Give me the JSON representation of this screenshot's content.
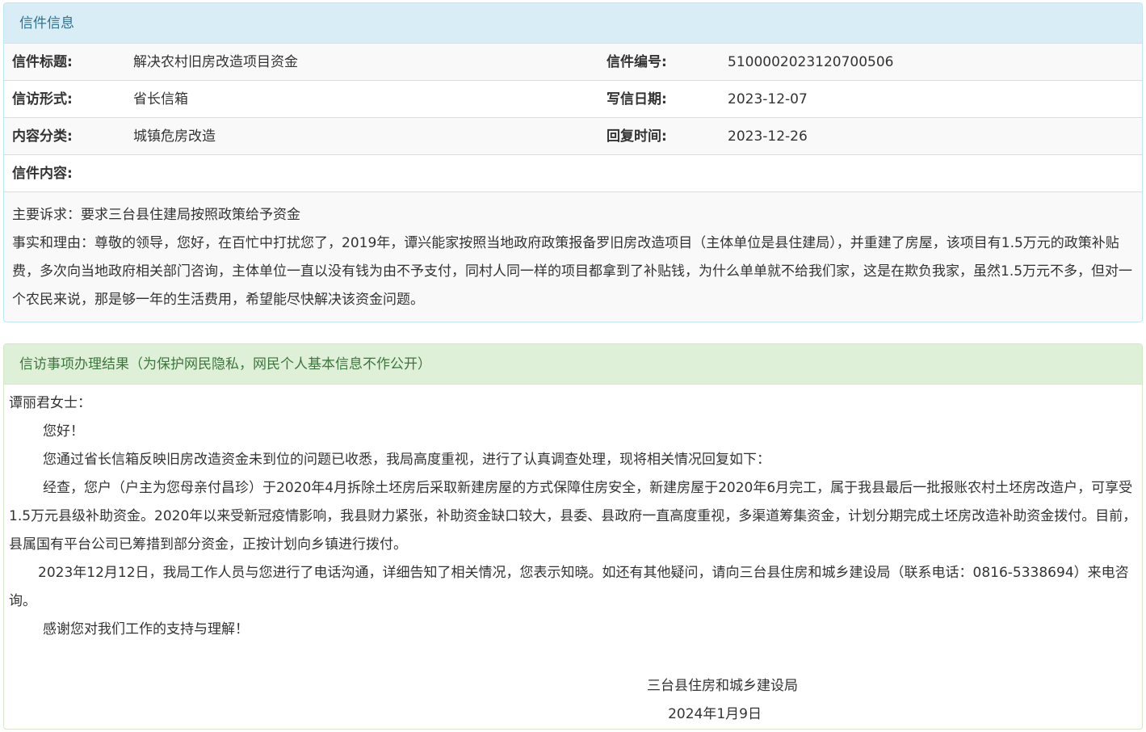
{
  "letter_panel": {
    "heading": "信件信息",
    "fields": {
      "title_label": "信件标题:",
      "title_value": "解决农村旧房改造项目资金",
      "number_label": "信件编号:",
      "number_value": "5100002023120700506",
      "form_label": "信访形式:",
      "form_value": "省长信箱",
      "write_date_label": "写信日期:",
      "write_date_value": "2023-12-07",
      "category_label": "内容分类:",
      "category_value": "城镇危房改造",
      "reply_time_label": "回复时间:",
      "reply_time_value": "2023-12-26",
      "content_label": "信件内容:"
    },
    "content": {
      "demand": "主要诉求：要求三台县住建局按照政策给予资金",
      "facts": "事实和理由：尊敬的领导，您好，在百忙中打扰您了，2019年，谭兴能家按照当地政府政策报备罗旧房改造项目（主体单位是县住建局），并重建了房屋，该项目有1.5万元的政策补贴费，多次向当地政府相关部门咨询，主体单位一直以没有钱为由不予支付，同村人同一样的项目都拿到了补贴钱，为什么单单就不给我们家，这是在欺负我家，虽然1.5万元不多，但对一个农民来说，那是够一年的生活费用，希望能尽快解决该资金问题。"
    }
  },
  "result_panel": {
    "heading": "信访事项办理结果（为保护网民隐私，网民个人基本信息不作公开）",
    "salutation": "谭丽君女士：",
    "greeting": "您好！",
    "p1": "您通过省长信箱反映旧房改造资金未到位的问题已收悉，我局高度重视，进行了认真调查处理，现将相关情况回复如下：",
    "p2": "经查，您户（户主为您母亲付昌珍）于2020年4月拆除土坯房后采取新建房屋的方式保障住房安全，新建房屋于2020年6月完工，属于我县最后一批报账农村土坯房改造户，可享受1.5万元县级补助资金。2020年以来受新冠疫情影响，我县财力紧张，补助资金缺口较大，县委、县政府一直高度重视，多渠道筹集资金，计划分期完成土坯房改造补助资金拨付。目前，县属国有平台公司已筹措到部分资金，正按计划向乡镇进行拨付。",
    "p3": "2023年12月12日，我局工作人员与您进行了电话沟通，详细告知了相关情况，您表示知晓。如还有其他疑问，请向三台县住房和城乡建设局（联系电话：0816-5338694）来电咨询。",
    "p4": "感谢您对我们工作的支持与理解！",
    "signature_org": "三台县住房和城乡建设局",
    "signature_date": "2024年1月9日"
  }
}
